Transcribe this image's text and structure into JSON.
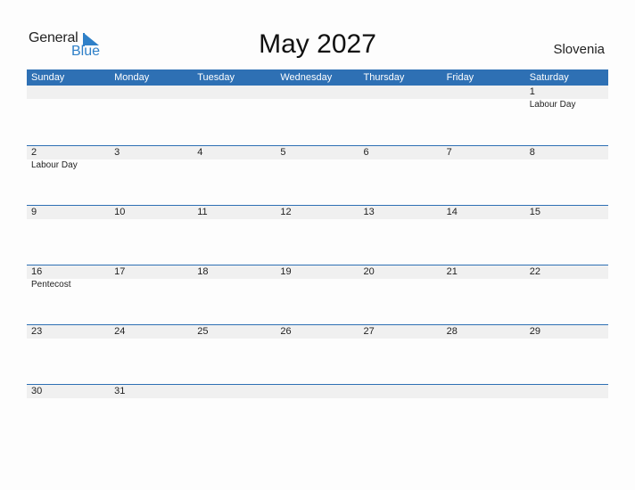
{
  "logo": {
    "general": "General",
    "blue": "Blue",
    "accent": "#2f80c8"
  },
  "title": "May 2027",
  "country": "Slovenia",
  "colors": {
    "header": "#2e70b4",
    "band": "#f0f0f0"
  },
  "weekdays": [
    "Sunday",
    "Monday",
    "Tuesday",
    "Wednesday",
    "Thursday",
    "Friday",
    "Saturday"
  ],
  "weeks": [
    [
      {
        "d": ""
      },
      {
        "d": ""
      },
      {
        "d": ""
      },
      {
        "d": ""
      },
      {
        "d": ""
      },
      {
        "d": ""
      },
      {
        "d": "1",
        "h": "Labour Day"
      }
    ],
    [
      {
        "d": "2",
        "h": "Labour Day"
      },
      {
        "d": "3"
      },
      {
        "d": "4"
      },
      {
        "d": "5"
      },
      {
        "d": "6"
      },
      {
        "d": "7"
      },
      {
        "d": "8"
      }
    ],
    [
      {
        "d": "9"
      },
      {
        "d": "10"
      },
      {
        "d": "11"
      },
      {
        "d": "12"
      },
      {
        "d": "13"
      },
      {
        "d": "14"
      },
      {
        "d": "15"
      }
    ],
    [
      {
        "d": "16",
        "h": "Pentecost"
      },
      {
        "d": "17"
      },
      {
        "d": "18"
      },
      {
        "d": "19"
      },
      {
        "d": "20"
      },
      {
        "d": "21"
      },
      {
        "d": "22"
      }
    ],
    [
      {
        "d": "23"
      },
      {
        "d": "24"
      },
      {
        "d": "25"
      },
      {
        "d": "26"
      },
      {
        "d": "27"
      },
      {
        "d": "28"
      },
      {
        "d": "29"
      }
    ],
    [
      {
        "d": "30"
      },
      {
        "d": "31"
      },
      {
        "d": ""
      },
      {
        "d": ""
      },
      {
        "d": ""
      },
      {
        "d": ""
      },
      {
        "d": ""
      }
    ]
  ]
}
